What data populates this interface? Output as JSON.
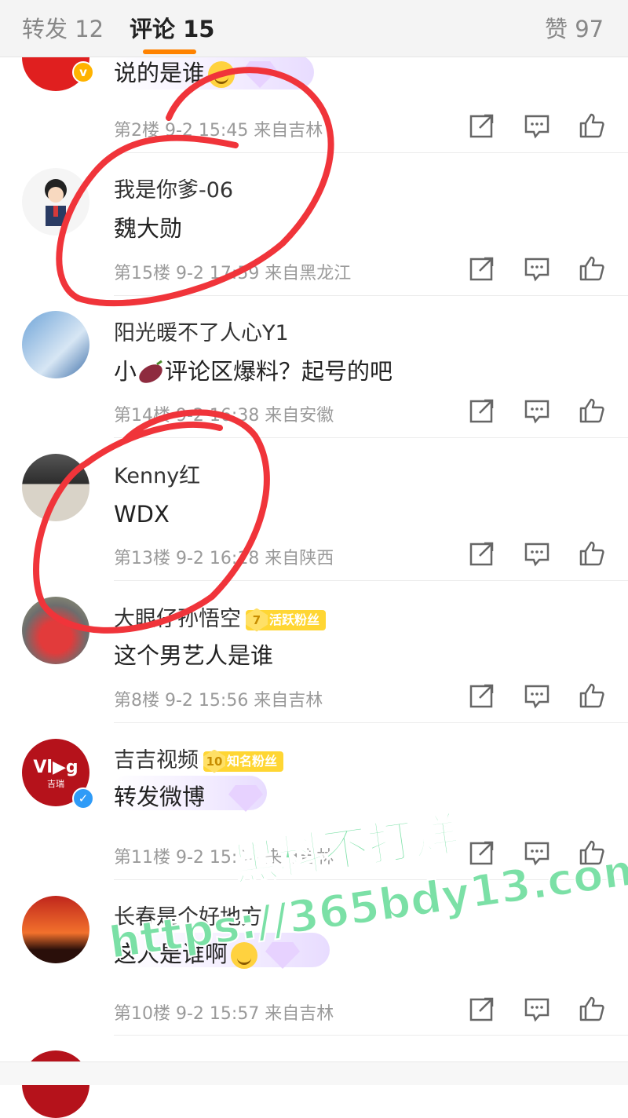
{
  "tabs": {
    "repost": "转发 12",
    "comments": "评论 15",
    "likes": "赞 97"
  },
  "comments": [
    {
      "author": "",
      "text": "说的是谁",
      "meta": "第2楼  9-2 15:45  来自吉林"
    },
    {
      "author": "我是你爹-06",
      "text": "魏大勋",
      "meta": "第15楼  9-2 17:59  来自黑龙江"
    },
    {
      "author": "阳光暖不了人心Y1",
      "text_a": "小",
      "text_b": "评论区爆料？起号的吧",
      "meta": "第14楼  9-2 16:38  来自安徽"
    },
    {
      "author": "Kenny红",
      "text": "WDX",
      "meta": "第13楼  9-2 16:18  来自陕西"
    },
    {
      "author": "大眼仔孙悟空",
      "badge_level": "7",
      "badge_text": "活跃粉丝",
      "text": "这个男艺人是谁",
      "meta": "第8楼  9-2 15:56  来自吉林"
    },
    {
      "author": "吉吉视频",
      "badge_level": "10",
      "badge_text": "知名粉丝",
      "text": "转发微博",
      "meta": "第11楼  9-2 15:56  来自吉林",
      "avatar_text": "Vl▶g",
      "avatar_sub": "吉瑞"
    },
    {
      "author": "长春是个好地方",
      "text": "这人是谁啊",
      "meta": "第10楼  9-2 15:57  来自吉林"
    }
  ],
  "icons": [
    "share-icon",
    "reply-icon",
    "like-icon"
  ],
  "watermark": {
    "line1": "黑料不打烊",
    "line2": "https://365bdy13.com"
  },
  "colors": {
    "accent": "#ff8200",
    "annotation": "#f0343a",
    "watermark": "#7be0a6"
  }
}
